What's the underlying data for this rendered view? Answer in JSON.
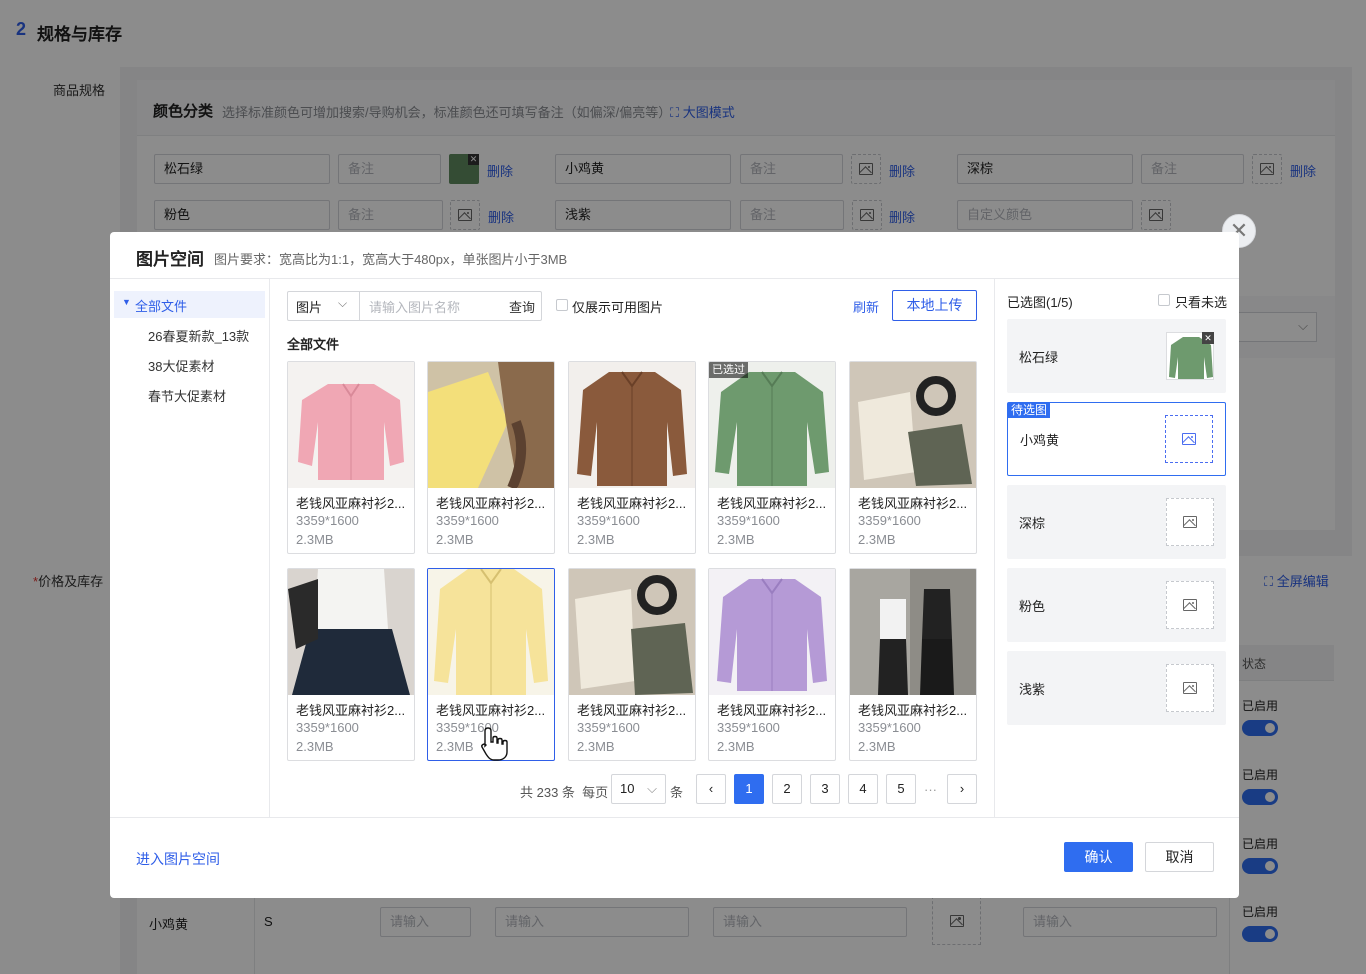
{
  "page": {
    "section_num": "2",
    "section_title": "规格与库存",
    "spec_label": "商品规格",
    "price_label": "价格及库存",
    "price_required": "*"
  },
  "color_group": {
    "title": "颜色分类",
    "hint": "选择标准颜色可增加搜索/导购机会，标准颜色还可填写备注（如偏深/偏亮等）",
    "bigmode_label": "大图模式",
    "delete_label": "删除",
    "note_placeholder": "备注",
    "custom_placeholder": "自定义颜色",
    "colors": [
      "松石绿",
      "小鸡黄",
      "深棕",
      "粉色",
      "浅紫"
    ]
  },
  "table": {
    "fullscreen_label": "全屏编辑",
    "status_header": "状态",
    "status_on": "已启用",
    "row_color": "小鸡黄",
    "row_size": "S",
    "input_placeholder": "请输入"
  },
  "modal": {
    "title": "图片空间",
    "requirement": "图片要求：宽高比为1:1，宽高大于480px，单张图片小于3MB",
    "folders": [
      "全部文件",
      "26春夏新款_13款",
      "38大促素材",
      "春节大促素材"
    ],
    "filter_type": "图片",
    "search_placeholder": "请输入图片名称",
    "search_button": "查询",
    "only_available": "仅展示可用图片",
    "refresh": "刷新",
    "upload": "本地上传",
    "breadcrumb": "全部文件",
    "used_tag": "已选过",
    "images": [
      {
        "name": "老钱风亚麻衬衫2...",
        "dim": "3359*1600",
        "size": "2.3MB"
      },
      {
        "name": "老钱风亚麻衬衫2...",
        "dim": "3359*1600",
        "size": "2.3MB"
      },
      {
        "name": "老钱风亚麻衬衫2...",
        "dim": "3359*1600",
        "size": "2.3MB"
      },
      {
        "name": "老钱风亚麻衬衫2...",
        "dim": "3359*1600",
        "size": "2.3MB"
      },
      {
        "name": "老钱风亚麻衬衫2...",
        "dim": "3359*1600",
        "size": "2.3MB"
      },
      {
        "name": "老钱风亚麻衬衫2...",
        "dim": "3359*1600",
        "size": "2.3MB"
      },
      {
        "name": "老钱风亚麻衬衫2...",
        "dim": "3359*1600",
        "size": "2.3MB"
      },
      {
        "name": "老钱风亚麻衬衫2...",
        "dim": "3359*1600",
        "size": "2.3MB"
      },
      {
        "name": "老钱风亚麻衬衫2...",
        "dim": "3359*1600",
        "size": "2.3MB"
      },
      {
        "name": "老钱风亚麻衬衫2...",
        "dim": "3359*1600",
        "size": "2.3MB"
      }
    ],
    "pagination": {
      "total_text": "共 233 条",
      "per_page_label": "每页",
      "per_page": "10",
      "unit": "条",
      "pages": [
        "1",
        "2",
        "3",
        "4",
        "5"
      ],
      "current": "1",
      "ellipsis": "···"
    },
    "selected": {
      "title": "已选图(1/5)",
      "only_unselected": "只看未选",
      "pending_tag": "待选图",
      "slots": [
        "松石绿",
        "小鸡黄",
        "深棕",
        "粉色",
        "浅紫"
      ]
    },
    "enter_space": "进入图片空间",
    "confirm": "确认",
    "cancel": "取消"
  },
  "colors": {
    "accent": "#2f6df0",
    "link": "#2f5ee8",
    "mask": "rgba(0,0,0,0.45)"
  }
}
